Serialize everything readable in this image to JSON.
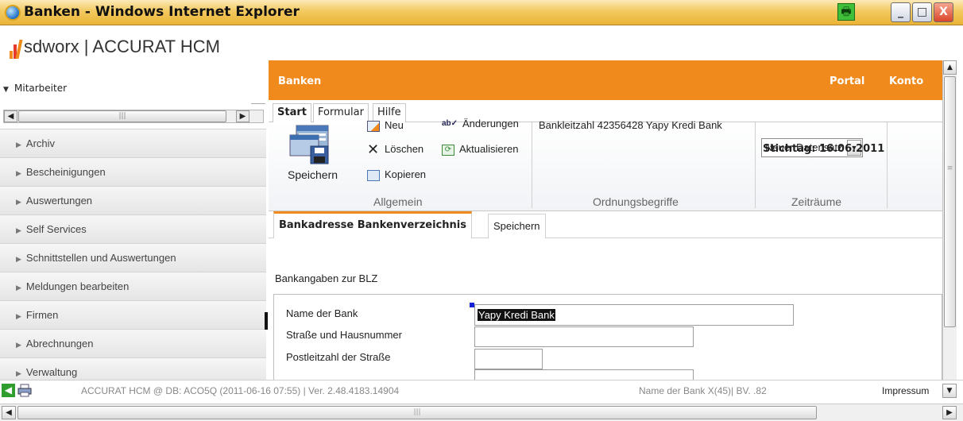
{
  "window": {
    "title": "Banken - Windows Internet Explorer",
    "controls": [
      "_",
      "□",
      "X"
    ]
  },
  "left": {
    "logo_text": "sdworx | ACCURAT HCM",
    "section": "Mitarbeiter",
    "nav": [
      "Archiv",
      "Bescheinigungen",
      "Auswertungen",
      "Self Services",
      "Schnittstellen und Auswertungen",
      "Meldungen bearbeiten",
      "Firmen",
      "Abrechnungen",
      "Verwaltung"
    ]
  },
  "header": {
    "title": "Banken",
    "portal": "Portal",
    "konto": "Konto"
  },
  "ribbon": {
    "tabs": [
      "Start",
      "Formular",
      "Hilfe"
    ],
    "save": "Speichern",
    "neu": "Neu",
    "loeschen": "Löschen",
    "kopieren": "Kopieren",
    "aenderungen": "Änderungen",
    "aktualisieren": "Aktualisieren",
    "group_allgemein": "Allgemein",
    "bankleitzahl": "Bankleitzahl 42356428 Yapy Kredi Bank",
    "group_ordnung": "Ordnungsbegriffe",
    "neuer_datensatz": "Neuer Datensatz",
    "stichtag": "Stichtag: 16.06.2011",
    "group_zeitraeume": "Zeiträume"
  },
  "form": {
    "tab_active": "Bankadresse Bankenverzeichnis",
    "tab_save": "Speichern",
    "section": "Bankangaben zur BLZ",
    "label_name": "Name der Bank",
    "value_name": "Yapy Kredi Bank",
    "label_strasse": "Straße und Hausnummer",
    "label_plz": "Postleitzahl der Straße"
  },
  "status": {
    "text": "ACCURAT HCM @ DB: ACO5Q (2011-06-16 07:55) | Ver. 2.48.4183.14904",
    "field_info": "Name der Bank X(45)| BV. .82",
    "impressum": "Impressum"
  }
}
